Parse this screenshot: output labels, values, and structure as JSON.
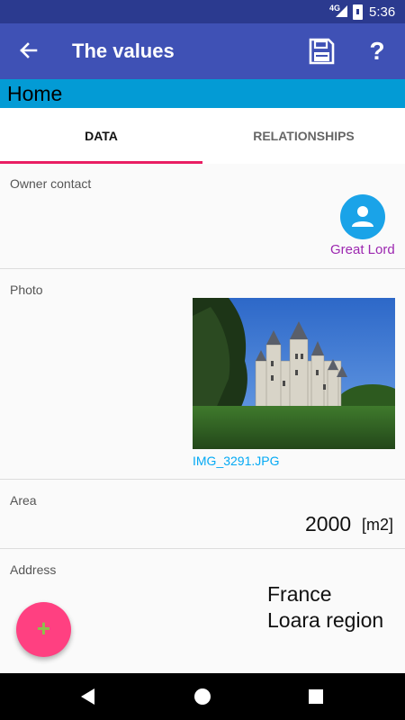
{
  "status_bar": {
    "network": "4G",
    "time": "5:36"
  },
  "app_bar": {
    "title": "The values",
    "back_icon": "arrow-left-icon",
    "save_icon": "floppy-disk-icon",
    "help_label": "?"
  },
  "home_bar": {
    "title": "Home"
  },
  "tabs": [
    {
      "label": "DATA",
      "active": true
    },
    {
      "label": "RELATIONSHIPS",
      "active": false
    }
  ],
  "owner_contact": {
    "label": "Owner contact",
    "name": "Great Lord",
    "icon": "person-icon"
  },
  "photo": {
    "label": "Photo",
    "filename": "IMG_3291.JPG"
  },
  "area": {
    "label": "Area",
    "value": "2000",
    "unit": "[m2]"
  },
  "address": {
    "label": "Address",
    "lines": [
      "France",
      "Loara region"
    ]
  },
  "fab": {
    "label": "+"
  },
  "colors": {
    "app_bar": "#3f51b5",
    "status_bar": "#2b3a8f",
    "home_bar": "#039bd5",
    "tab_indicator": "#e91e63",
    "contact_name": "#9c27b0",
    "filename": "#03a9f4",
    "fab": "#ff4081"
  }
}
